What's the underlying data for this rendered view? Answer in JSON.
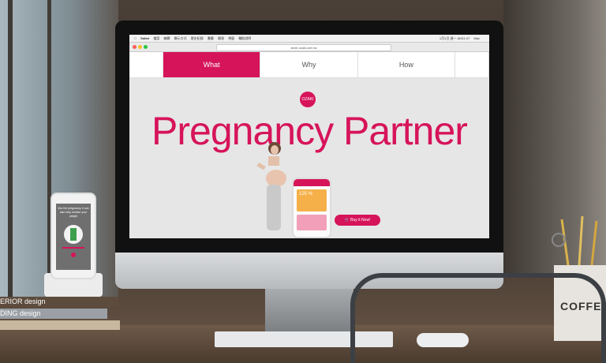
{
  "browser": {
    "menubar": [
      "Safari",
      "檔案",
      "編輯",
      "顯示方式",
      "歷史紀錄",
      "書籤",
      "開發",
      "視窗",
      "輔助說明"
    ],
    "menubar_right": "1月1日 週一 AM11:47",
    "menubar_user": "Mac",
    "url": "store.ozaki.com.tw"
  },
  "nav": {
    "tabs": [
      {
        "label": "What",
        "active": true
      },
      {
        "label": "Why",
        "active": false
      },
      {
        "label": "How",
        "active": false
      }
    ]
  },
  "page": {
    "logo": "OZAKI",
    "headline": "Pregnancy Partner",
    "buy_label": "Buy it Now!",
    "phone_stat": "125 %"
  },
  "side_phone": {
    "text": "Into the pregnancy, it can also help monitor your weight"
  },
  "books": [
    "ERIOR design",
    "DING design"
  ],
  "cup_text": "COFFEE",
  "colors": {
    "accent": "#d6145a"
  }
}
